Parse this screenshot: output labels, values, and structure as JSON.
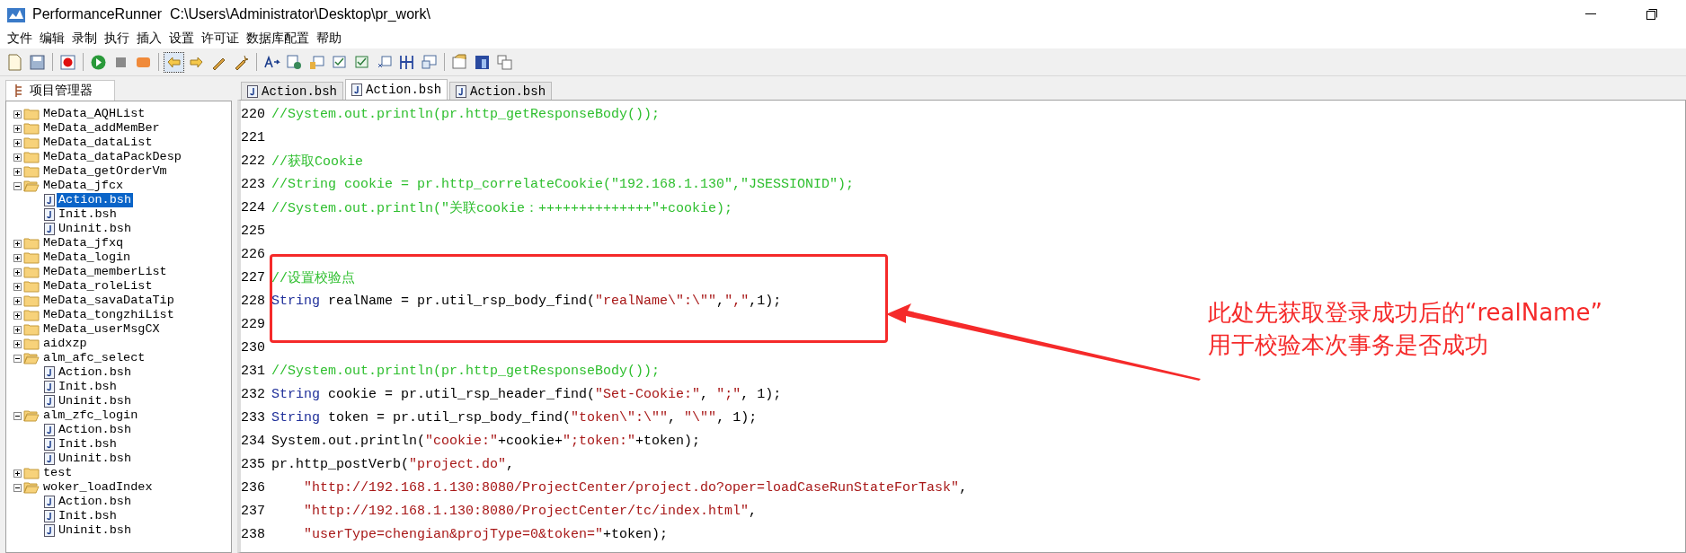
{
  "window": {
    "title": "PerformanceRunner  C:\\Users\\Administrator\\Desktop\\pr_work\\"
  },
  "menu": [
    "文件",
    "编辑",
    "录制",
    "执行",
    "插入",
    "设置",
    "许可证",
    "数据库配置",
    "帮助"
  ],
  "project_panel": {
    "title": "项目管理器",
    "tree": [
      {
        "label": "MeData_AQHList",
        "expanded": false
      },
      {
        "label": "MeData_addMemBer",
        "expanded": false
      },
      {
        "label": "MeData_dataList",
        "expanded": false
      },
      {
        "label": "MeData_dataPackDesp",
        "expanded": false
      },
      {
        "label": "MeData_getOrderVm",
        "expanded": false
      },
      {
        "label": "MeData_jfcx",
        "expanded": true,
        "children": [
          {
            "label": "Action.bsh",
            "selected": true
          },
          {
            "label": "Init.bsh",
            "selected": false
          },
          {
            "label": "Uninit.bsh",
            "selected": false
          }
        ]
      },
      {
        "label": "MeData_jfxq",
        "expanded": false
      },
      {
        "label": "MeData_login",
        "expanded": false
      },
      {
        "label": "MeData_memberList",
        "expanded": false
      },
      {
        "label": "MeData_roleList",
        "expanded": false
      },
      {
        "label": "MeData_savaDataTip",
        "expanded": false
      },
      {
        "label": "MeData_tongzhiList",
        "expanded": false
      },
      {
        "label": "MeData_userMsgCX",
        "expanded": false
      },
      {
        "label": "aidxzp",
        "expanded": false
      },
      {
        "label": "alm_afc_select",
        "expanded": true,
        "children": [
          {
            "label": "Action.bsh",
            "selected": false
          },
          {
            "label": "Init.bsh",
            "selected": false
          },
          {
            "label": "Uninit.bsh",
            "selected": false
          }
        ]
      },
      {
        "label": "alm_zfc_login",
        "expanded": true,
        "children": [
          {
            "label": "Action.bsh",
            "selected": false
          },
          {
            "label": "Init.bsh",
            "selected": false
          },
          {
            "label": "Uninit.bsh",
            "selected": false
          }
        ]
      },
      {
        "label": "test",
        "expanded": false
      },
      {
        "label": "woker_loadIndex",
        "expanded": true,
        "children": [
          {
            "label": "Action.bsh",
            "selected": false
          },
          {
            "label": "Init.bsh",
            "selected": false
          },
          {
            "label": "Uninit.bsh",
            "selected": false
          }
        ]
      }
    ]
  },
  "editor": {
    "tabs": [
      {
        "label": "Action.bsh",
        "selected": false
      },
      {
        "label": "Action.bsh",
        "selected": true
      },
      {
        "label": "Action.bsh",
        "selected": false
      }
    ],
    "lines": [
      {
        "number": "220",
        "segments": [
          {
            "kind": "comment",
            "text": "//System.out.println(pr.http_getResponseBody());"
          }
        ]
      },
      {
        "number": "221"
      },
      {
        "number": "222",
        "segments": [
          {
            "kind": "comment",
            "text": "//获取Cookie"
          }
        ]
      },
      {
        "number": "223",
        "segments": [
          {
            "kind": "comment",
            "text": "//String cookie = pr.http_correlateCookie(\"192.168.1.130\",\"JSESSIONID\");"
          }
        ]
      },
      {
        "number": "224",
        "segments": [
          {
            "kind": "comment",
            "text": "//System.out.println(\"关联cookie：++++++++++++++\"+cookie);"
          }
        ]
      },
      {
        "number": "225"
      },
      {
        "number": "226"
      },
      {
        "number": "227",
        "segments": [
          {
            "kind": "comment",
            "text": "//设置校验点"
          }
        ]
      },
      {
        "number": "228",
        "segments": [
          {
            "kind": "keyword",
            "text": "String"
          },
          {
            "kind": "plain",
            "text": " realName = pr.util_rsp_body_find("
          },
          {
            "kind": "string",
            "text": "\"realName\\\":\\\"\""
          },
          {
            "kind": "plain",
            "text": ","
          },
          {
            "kind": "string",
            "text": "\",\""
          },
          {
            "kind": "plain",
            "text": ",1);"
          }
        ]
      },
      {
        "number": "229"
      },
      {
        "number": "230"
      },
      {
        "number": "231",
        "segments": [
          {
            "kind": "comment",
            "text": "//System.out.println(pr.http_getResponseBody());"
          }
        ]
      },
      {
        "number": "232",
        "segments": [
          {
            "kind": "keyword",
            "text": "String"
          },
          {
            "kind": "plain",
            "text": " cookie = pr.util_rsp_header_find("
          },
          {
            "kind": "string",
            "text": "\"Set-Cookie:\""
          },
          {
            "kind": "plain",
            "text": ", "
          },
          {
            "kind": "string",
            "text": "\";\""
          },
          {
            "kind": "plain",
            "text": ", 1);"
          }
        ]
      },
      {
        "number": "233",
        "segments": [
          {
            "kind": "keyword",
            "text": "String"
          },
          {
            "kind": "plain",
            "text": " token = pr.util_rsp_body_find("
          },
          {
            "kind": "string",
            "text": "\"token\\\":\\\"\""
          },
          {
            "kind": "plain",
            "text": ", "
          },
          {
            "kind": "string",
            "text": "\"\\\"\""
          },
          {
            "kind": "plain",
            "text": ", 1);"
          }
        ]
      },
      {
        "number": "234",
        "segments": [
          {
            "kind": "plain",
            "text": "System.out.println("
          },
          {
            "kind": "string",
            "text": "\"cookie:\""
          },
          {
            "kind": "plain",
            "text": "+cookie+"
          },
          {
            "kind": "string",
            "text": "\";token:\""
          },
          {
            "kind": "plain",
            "text": "+token);"
          }
        ]
      },
      {
        "number": "235",
        "segments": [
          {
            "kind": "plain",
            "text": "pr.http_postVerb("
          },
          {
            "kind": "string",
            "text": "\"project.do\""
          },
          {
            "kind": "plain",
            "text": ","
          }
        ]
      },
      {
        "number": "236",
        "indented": true,
        "segments": [
          {
            "kind": "string",
            "text": "\"http://192.168.1.130:8080/ProjectCenter/project.do?oper=loadCaseRunStateForTask\""
          },
          {
            "kind": "plain",
            "text": ","
          }
        ]
      },
      {
        "number": "237",
        "indented": true,
        "segments": [
          {
            "kind": "string",
            "text": "\"http://192.168.1.130:8080/ProjectCenter/tc/index.html\""
          },
          {
            "kind": "plain",
            "text": ","
          }
        ]
      },
      {
        "number": "238",
        "indented": true,
        "segments": [
          {
            "kind": "string",
            "text": "\"userType=chengian&projType=0&token=\""
          },
          {
            "kind": "plain",
            "text": "+token);"
          }
        ]
      }
    ]
  },
  "annotation": {
    "lines": [
      "此处先获取登录成功后的“realName”",
      "用于校验本次事务是否成功"
    ]
  }
}
